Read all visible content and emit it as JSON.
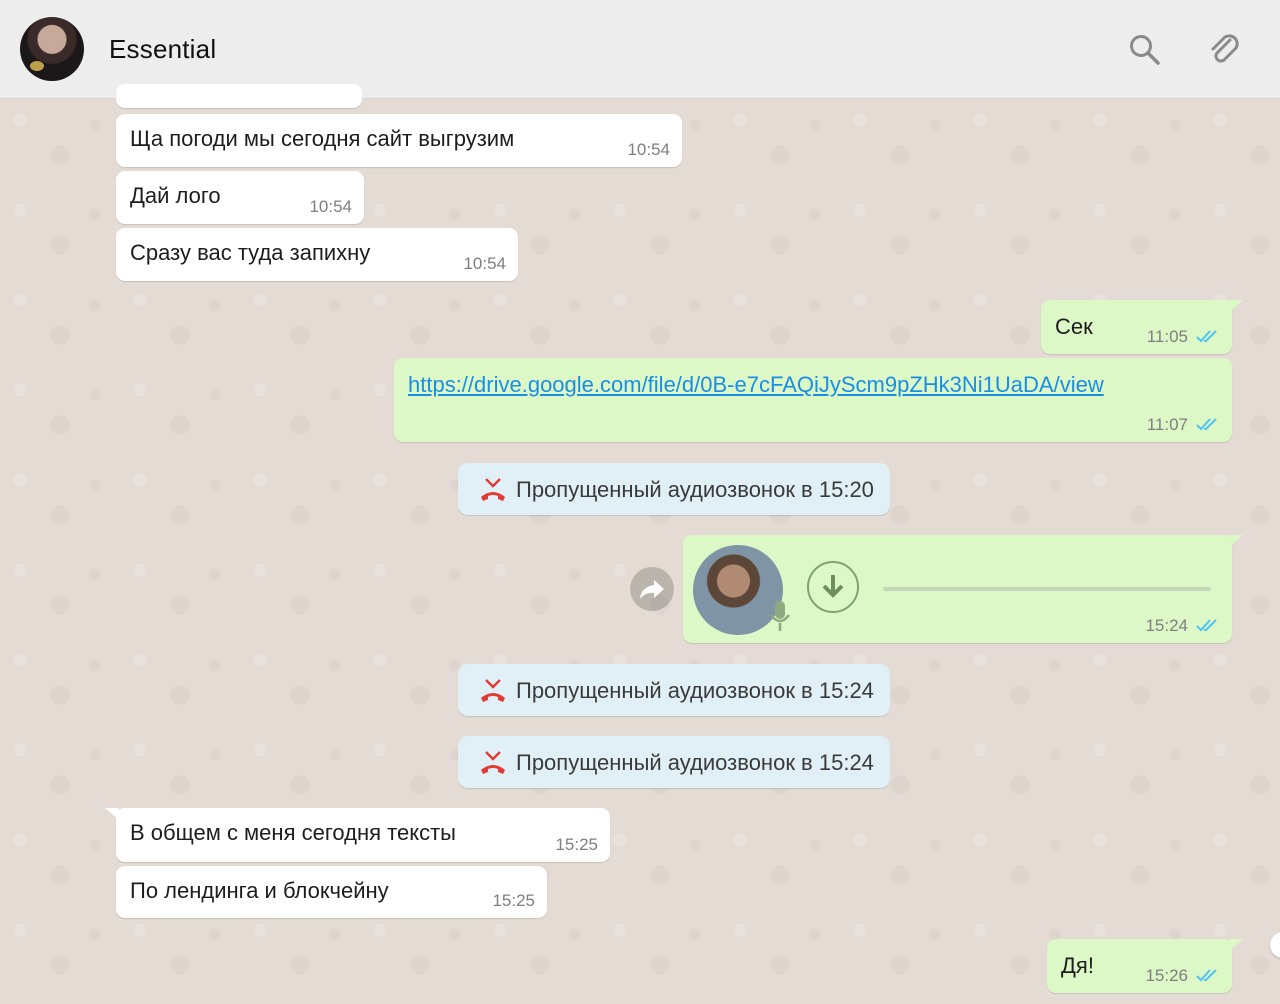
{
  "header": {
    "contact_name": "Essential",
    "icons": [
      "search-icon",
      "paperclip-icon"
    ]
  },
  "messages": {
    "m1": {
      "text": "Ща погоди мы сегодня сайт выгрузим",
      "time": "10:54"
    },
    "m2": {
      "text": "Дай лого",
      "time": "10:54"
    },
    "m3": {
      "text": "Сразу вас туда запихну",
      "time": "10:54"
    },
    "m4": {
      "text": "Сек",
      "time": "11:05"
    },
    "m5": {
      "text": "https://drive.google.com/file/d/0B-e7cFAQiJyScm9pZHk3Ni1UaDA/view",
      "time": "11:07"
    },
    "s1": {
      "text": "Пропущенный аудиозвонок в 15:20"
    },
    "voice": {
      "time": "15:24"
    },
    "s2": {
      "text": "Пропущенный аудиозвонок в 15:24"
    },
    "s3": {
      "text": "Пропущенный аудиозвонок в 15:24"
    },
    "m6": {
      "text": "В общем с меня сегодня тексты",
      "time": "15:25"
    },
    "m7": {
      "text": "По лендинга и блокчейну",
      "time": "15:25"
    },
    "m8": {
      "text": "Дя!",
      "time": "15:26"
    }
  },
  "colors": {
    "incoming": "#ffffff",
    "outgoing": "#dcf8c6",
    "system": "#e1f0f7",
    "read_ticks": "#4fc3f7",
    "missed_call": "#e53935",
    "link": "#1b8ee4"
  }
}
